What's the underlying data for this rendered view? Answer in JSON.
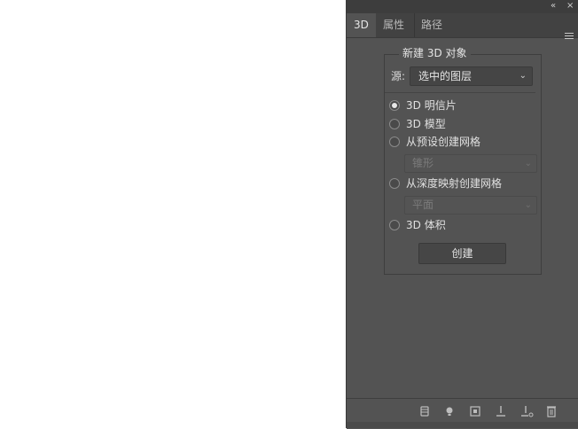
{
  "panel": {
    "tabs": [
      {
        "label": "3D",
        "active": true
      },
      {
        "label": "属性",
        "active": false
      },
      {
        "label": "路径",
        "active": false
      }
    ],
    "top_controls": {
      "collapse_icon": "double-chevron-left-icon",
      "close_icon": "close-icon"
    },
    "menu_icon": "hamburger-menu-icon"
  },
  "new_object": {
    "legend": "新建 3D 对象",
    "source_label": "源:",
    "source_value": "选中的图层",
    "options": [
      {
        "label": "3D 明信片",
        "selected": true
      },
      {
        "label": "3D 模型",
        "selected": false
      },
      {
        "label": "从预设创建网格",
        "selected": false
      },
      {
        "label": "从深度映射创建网格",
        "selected": false
      },
      {
        "label": "3D 体积",
        "selected": false
      }
    ],
    "preset_select_value": "锥形",
    "depth_select_value": "平面",
    "create_button": "创建"
  },
  "footer_icons": [
    "filter-by-scene-icon",
    "light-bulb-icon",
    "render-icon",
    "add-light-icon",
    "delete-icon",
    "trash-icon"
  ],
  "colors": {
    "panel_bg": "#535353",
    "tab_bar": "#424242",
    "text": "#dcdcdc"
  }
}
